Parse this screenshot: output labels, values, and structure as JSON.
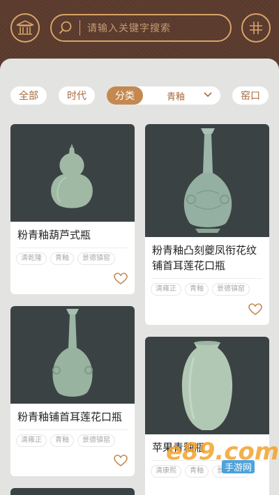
{
  "search": {
    "placeholder": "请输入关键字搜索"
  },
  "filters": {
    "all": "全部",
    "era": "时代",
    "category": "分类",
    "category_value": "青釉",
    "kiln": "窑口"
  },
  "cards": [
    {
      "title": "粉青釉葫芦式瓶",
      "tags": [
        "清乾隆",
        "青釉",
        "景德镇窑"
      ]
    },
    {
      "title": "粉青釉凸刻夔凤衔花纹铺首耳莲花口瓶",
      "tags": [
        "清雍正",
        "青釉",
        "景德镇窑"
      ]
    },
    {
      "title": "粉青釉铺首耳莲花口瓶",
      "tags": [
        "清雍正",
        "青釉",
        "景德镇窑"
      ]
    },
    {
      "title": "苹果青釉瓶",
      "tags": [
        "清康熙",
        "青釉",
        "景德镇窑"
      ]
    }
  ],
  "watermark": {
    "logo": "e89.com",
    "site": "手游网"
  },
  "colors": {
    "brand": "#5b3b2d",
    "accent": "#d9a46a",
    "active": "#c48850",
    "panel": "#e3e4e2",
    "image_bg": "#3b4244"
  }
}
